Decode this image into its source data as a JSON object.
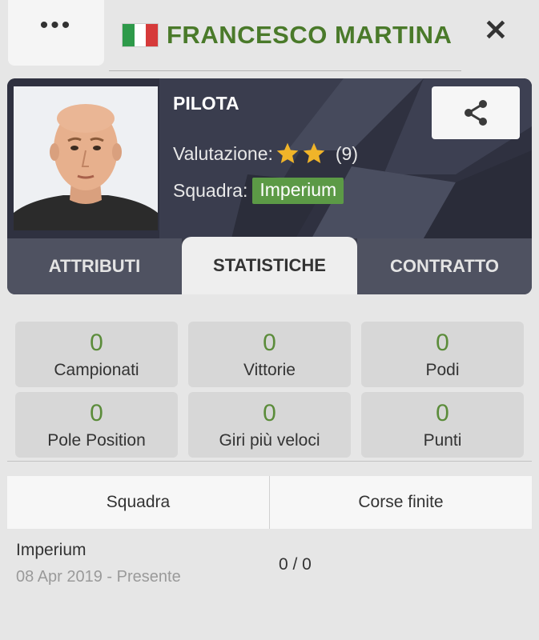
{
  "header": {
    "menu_label": "•••",
    "title": "FRANCESCO MARTINA",
    "flag_colors": [
      "#2e9a4a",
      "#ffffff",
      "#d63a3a"
    ],
    "close_label": "✕"
  },
  "driver": {
    "role": "PILOTA",
    "rating_label": "Valutazione:",
    "rating_stars": 2,
    "rating_count": "(9)",
    "team_label": "Squadra:",
    "team_name": "Imperium",
    "share_icon": "share-icon"
  },
  "tabs": [
    {
      "label": "ATTRIBUTI",
      "active": false
    },
    {
      "label": "STATISTICHE",
      "active": true
    },
    {
      "label": "CONTRATTO",
      "active": false
    }
  ],
  "stats": [
    {
      "value": "0",
      "label": "Campionati"
    },
    {
      "value": "0",
      "label": "Vittorie"
    },
    {
      "value": "0",
      "label": "Podi"
    },
    {
      "value": "0",
      "label": "Pole Position"
    },
    {
      "value": "0",
      "label": "Giri più veloci"
    },
    {
      "value": "0",
      "label": "Punti"
    }
  ],
  "history": {
    "columns": [
      "Squadra",
      "Corse finite"
    ],
    "rows": [
      {
        "team": "Imperium",
        "period": "08 Apr 2019 - Presente",
        "races": "0 / 0"
      }
    ]
  },
  "colors": {
    "accent_green": "#4a7a2a",
    "stat_value": "#5b8c3a",
    "team_badge": "#5c9a46",
    "star": "#f0b429"
  }
}
